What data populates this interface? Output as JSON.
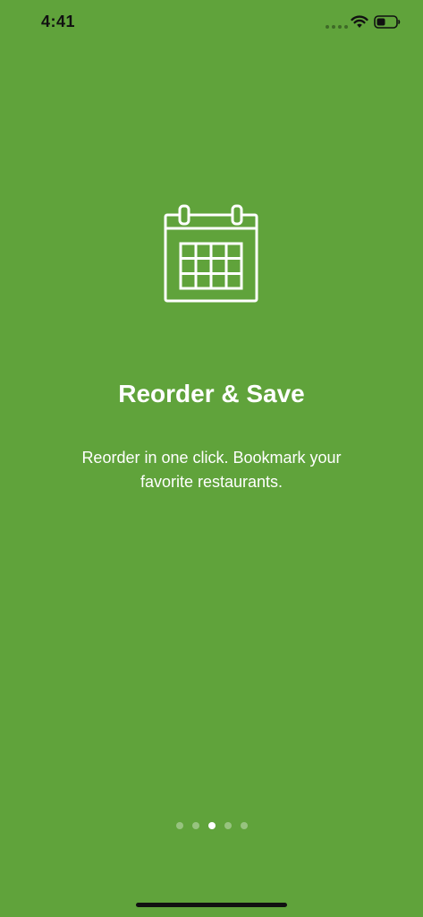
{
  "status_bar": {
    "time": "4:41",
    "icons": [
      "signal-dots-icon",
      "wifi-icon",
      "battery-icon"
    ],
    "text_color": "#111111"
  },
  "onboarding": {
    "icon": "calendar-icon",
    "title": "Reorder & Save",
    "description": "Reorder in one click. Bookmark your favorite restaurants.",
    "background_color": "#60a33b"
  },
  "pager": {
    "total_pages": 5,
    "current_page": 3
  }
}
